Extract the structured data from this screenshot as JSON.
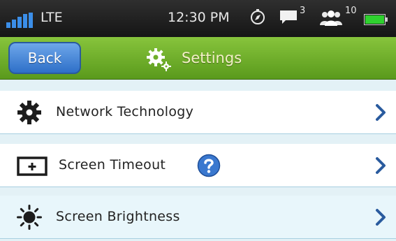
{
  "status_bar": {
    "network": "LTE",
    "time": "12:30 PM",
    "messages_count": "3",
    "contacts_count": "10",
    "icons": [
      "signal-icon",
      "compass-icon",
      "message-icon",
      "people-icon",
      "battery-icon"
    ]
  },
  "header": {
    "back_label": "Back",
    "title": "Settings",
    "icon": "gear-icon"
  },
  "settings": {
    "items": [
      {
        "label": "Network Technology",
        "icon": "gear-icon"
      },
      {
        "label": "Screen Timeout",
        "icon": "screen-timeout-icon",
        "help_icon": "help-icon"
      },
      {
        "label": "Screen Brightness",
        "icon": "brightness-icon"
      }
    ]
  },
  "colors": {
    "status_bar": "#1e1e1e",
    "title_bar": "#6fae2a",
    "back_button": "#3f7fd4",
    "title_text": "#f4f0c8",
    "row_divider": "#a7cfe0",
    "chevron": "#2a5b9e",
    "highlight_row": "#e8f6fb"
  }
}
